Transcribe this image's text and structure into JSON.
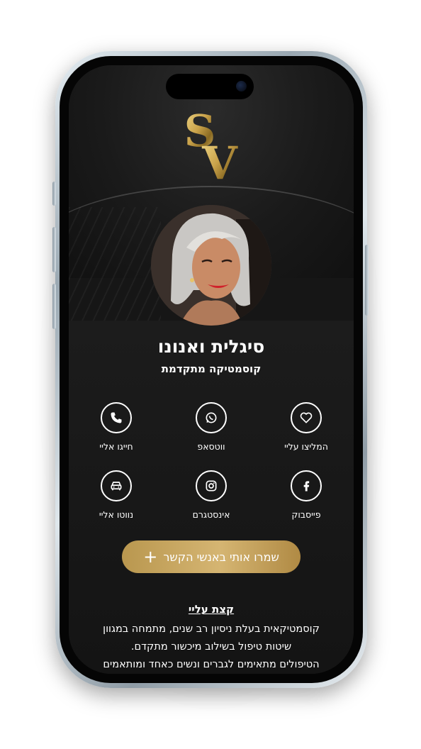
{
  "profile": {
    "name": "סיגלית ואנונו",
    "title": "קוסמטיקה מתקדמת",
    "logo_letters": "SV"
  },
  "actions": [
    {
      "label": "המליצו עליי",
      "icon": "heart-icon"
    },
    {
      "label": "ווטסאפ",
      "icon": "whatsapp-icon"
    },
    {
      "label": "חייגו אליי",
      "icon": "phone-icon"
    },
    {
      "label": "פייסבוק",
      "icon": "facebook-icon"
    },
    {
      "label": "אינסטגרם",
      "icon": "instagram-icon"
    },
    {
      "label": "נווטו אליי",
      "icon": "car-icon"
    }
  ],
  "save_contact": {
    "label": "שמרו אותי באנשי הקשר",
    "icon": "+"
  },
  "about": {
    "title": "קצת עליי",
    "lines": [
      "קוסמטיקאית בעלת ניסיון רב שנים, מתמחה במגוון",
      "שיטות טיפול בשילוב מיכשור מתקדם.",
      "הטיפולים מתאימים לגברים ונשים כאחד ומותאמים"
    ]
  },
  "colors": {
    "gold": "#c9a961",
    "background": "#161616",
    "text": "#ffffff"
  }
}
